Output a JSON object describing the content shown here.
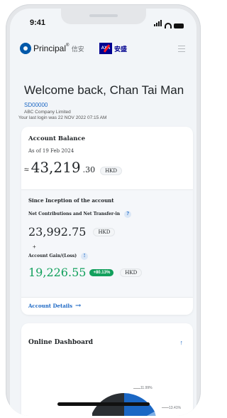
{
  "status_bar": {
    "time": "9:41"
  },
  "header": {
    "brand_name": "Principal",
    "brand_cn": "信安",
    "partner_logo_text": "AXA",
    "partner_cn": "安盛"
  },
  "welcome": {
    "greeting": "Welcome back, Chan Tai Man",
    "member_id": "SD00000",
    "company": "ABC Company Limited",
    "last_login": "Your last login was 22 NOV 2022 07:15 AM"
  },
  "account_balance": {
    "title": "Account Balance",
    "as_of": "As of 19 Feb 2024",
    "prefix": "≈",
    "amount_main": "43,219",
    "amount_decimal": ".30",
    "currency": "HKD"
  },
  "since_inception": {
    "title": "Since Inception of the account",
    "net_contrib_label": "Net Contributions and Net Transfer-in",
    "help_glyph": "?",
    "net_contrib_value": "23,992.75",
    "net_contrib_currency": "HKD",
    "plus_sign": "+",
    "gain_label": "Account Gain/(Loss)",
    "gain_help_glyph": "!",
    "gain_value": "19,226.55",
    "gain_pct": "+80.13%",
    "gain_currency": "HKD"
  },
  "account_details": {
    "label": "Account Details",
    "arrow": "→"
  },
  "dashboard": {
    "title": "Online Dashboard",
    "collapse_glyph": "↑",
    "pie_labels": [
      "11.99%",
      "13.41%"
    ]
  },
  "icons": {
    "hamburger": "menu-icon",
    "arrow": "arrow-right-icon"
  },
  "colors": {
    "brand_blue": "#0058a9",
    "link_blue": "#1b67c4",
    "gain_green": "#12a05c",
    "axa_blue": "#00008f",
    "axa_red": "#ff1721"
  }
}
